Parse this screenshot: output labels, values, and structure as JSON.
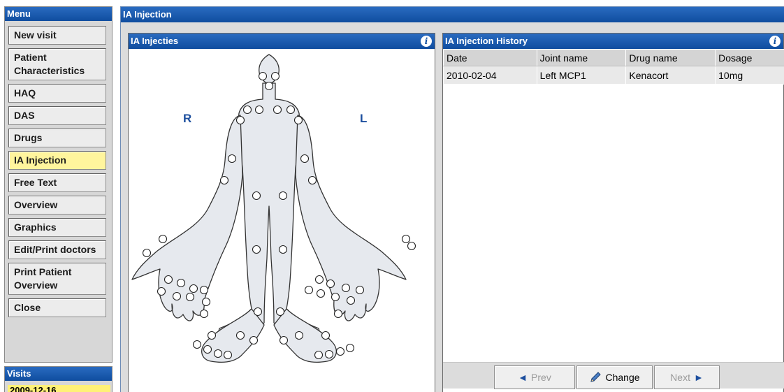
{
  "menu": {
    "title": "Menu",
    "items": [
      {
        "label": "New visit",
        "active": false
      },
      {
        "label": "Patient Characteristics",
        "active": false
      },
      {
        "label": "HAQ",
        "active": false
      },
      {
        "label": "DAS",
        "active": false
      },
      {
        "label": "Drugs",
        "active": false
      },
      {
        "label": "IA Injection",
        "active": true
      },
      {
        "label": "Free Text",
        "active": false
      },
      {
        "label": "Overview",
        "active": false
      },
      {
        "label": "Graphics",
        "active": false
      },
      {
        "label": "Edit/Print doctors",
        "active": false
      },
      {
        "label": "Print Patient Overview",
        "active": false
      },
      {
        "label": "Close",
        "active": false
      }
    ]
  },
  "visits": {
    "title": "Visits",
    "entry": "2009-12-16"
  },
  "main": {
    "title": "IA Injection"
  },
  "injecties": {
    "title": "IA Injecties",
    "right_label": "R",
    "left_label": "L"
  },
  "history": {
    "title": "IA Injection History",
    "columns": [
      "Date",
      "Joint name",
      "Drug name",
      "Dosage"
    ],
    "rows": [
      [
        "2010-02-04",
        "Left MCP1",
        "Kenacort",
        "10mg"
      ]
    ]
  },
  "nav": {
    "prev": "Prev",
    "change": "Change",
    "next": "Next"
  },
  "colors": {
    "header_blue": "#0f4d9f",
    "active_menu": "#fff59d",
    "body_fill": "#e6e9ee"
  }
}
